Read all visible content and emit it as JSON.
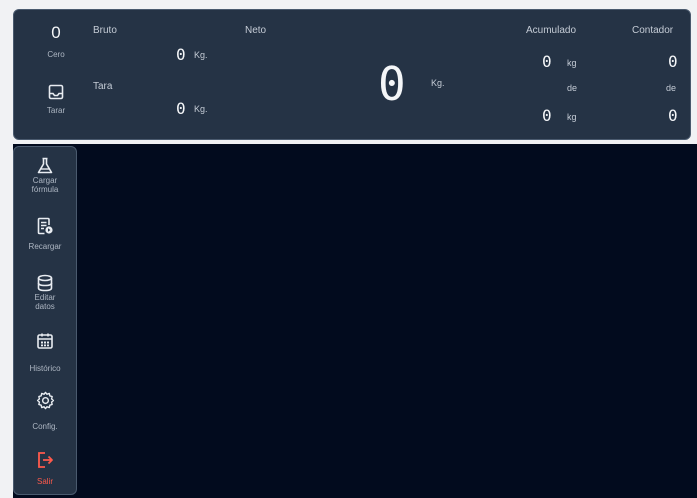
{
  "header": {
    "zero_value": "0",
    "zero_label": "Cero",
    "tare_button_label": "Tarar",
    "bruto_label": "Bruto",
    "bruto_value": "0",
    "bruto_unit": "Kg.",
    "tara_label": "Tara",
    "tara_value": "0",
    "tara_unit": "Kg.",
    "neto_label": "Neto",
    "neto_value": "0",
    "neto_unit": "Kg.",
    "acumulado_label": "Acumulado",
    "acumulado_value": "0",
    "acumulado_unit": "kg",
    "acumulado_de": "de",
    "acumulado_total": "0",
    "acumulado_total_unit": "kg",
    "contador_label": "Contador",
    "contador_value": "0",
    "contador_de": "de",
    "contador_total": "0"
  },
  "sidebar": {
    "items": [
      {
        "label_line1": "Cargar",
        "label_line2": "fórmula",
        "icon": "flask-icon"
      },
      {
        "label_line1": "Recargar",
        "label_line2": "",
        "icon": "recharge-document-icon"
      },
      {
        "label_line1": "Editar",
        "label_line2": "datos",
        "icon": "database-icon"
      },
      {
        "label_line1": "Histórico",
        "label_line2": "",
        "icon": "calendar-icon"
      },
      {
        "label_line1": "Config.",
        "label_line2": "",
        "icon": "gear-icon"
      },
      {
        "label_line1": "Salir",
        "label_line2": "",
        "icon": "exit-icon"
      }
    ]
  },
  "colors": {
    "panel": "#253345",
    "background": "#020b1e",
    "exit_accent": "#ff5a4c"
  }
}
